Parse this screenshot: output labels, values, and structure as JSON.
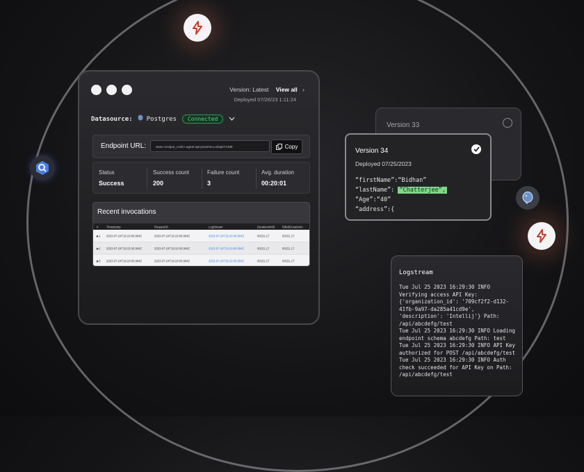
{
  "main_card": {
    "version_label": "Version: Latest",
    "view_all": "View all",
    "deployed": "Deployed 07/26/23 1:11:24",
    "datasource_label": "Datasource:",
    "datasource_name": "Postgres",
    "datasource_status": "Connected",
    "endpoint_label": "Endpoint URL:",
    "endpoint_url": "www.<unique_code>.agent-api.powerscu.ai/api/ACME",
    "copy_label": "Copy",
    "stats": [
      {
        "title": "Status",
        "value": "Success"
      },
      {
        "title": "Success count",
        "value": "200"
      },
      {
        "title": "Failure count",
        "value": "3"
      },
      {
        "title": "Avg. duration",
        "value": "00:20:01"
      }
    ],
    "recent_title": "Recent invocations",
    "table": {
      "headers": [
        "#",
        "Timestamp",
        "RequestID",
        "LogStream",
        "DurationInMS",
        "BilledDurationIn"
      ],
      "rows": [
        [
          "1",
          "2023-07-24T19:10:00.904Z",
          "2023-07-24T19:10:00.904Z",
          "2023-07-24T19:10:00.904Z",
          "00151.17",
          "00151.17"
        ],
        [
          "2",
          "2023-07-24T19:15:00.904Z",
          "2023-07-24T19:10:00.904Z",
          "2023-07-24T19:10:00.904Z",
          "00151.17",
          "00151.17"
        ],
        [
          "3",
          "2023-07-24T19:10:00.904Z",
          "2023-07-24T19:10:00.904Z",
          "2023-07-24T19:10:00.904Z",
          "00151.17",
          "00151.17"
        ]
      ]
    }
  },
  "version33": {
    "label": "Version 33"
  },
  "version34": {
    "label": "Version 34",
    "deployed": "Deployed 07/25/2023",
    "json_lines": [
      {
        "key": "“firstName”:",
        "value": "“Bidhan”",
        "highlight": false
      },
      {
        "key": "“lastName”: ",
        "value": "“Chatterjee”,",
        "highlight": true
      },
      {
        "key": "“Age”:",
        "value": "“40”",
        "highlight": false
      },
      {
        "key": "“address”:{",
        "value": "",
        "highlight": false
      }
    ]
  },
  "logstream": {
    "title": "Logstream",
    "text": "Tue Jul 25 2023 16:29:30 INFO Verifying access API Key: {'organization_id': '709cf2f2-d132-41fb-9a97-da285a41cd9e', 'description': 'Intellij'} Path: /api/abcdefg/test\nTue Jul 25 2023 16:29:30 INFO Loading endpoint schema abcdefg Path: test\nTue Jul 25 2023 16:29:30 INFO API Key authorized for POST /api/abcdefg/test\nTue Jul 25 2023 16:29:30 INFO Auth check succeeded for API Key on Path: /api/abcdefg/test"
  },
  "colors": {
    "connected": "#59d17f",
    "highlight": "#7fd68a",
    "link": "#3a7bd5"
  },
  "icons": [
    "bolt-icon",
    "bigquery-icon",
    "postgres-icon",
    "copy-icon",
    "check-icon",
    "chevron-down-icon",
    "chevron-right-icon"
  ]
}
